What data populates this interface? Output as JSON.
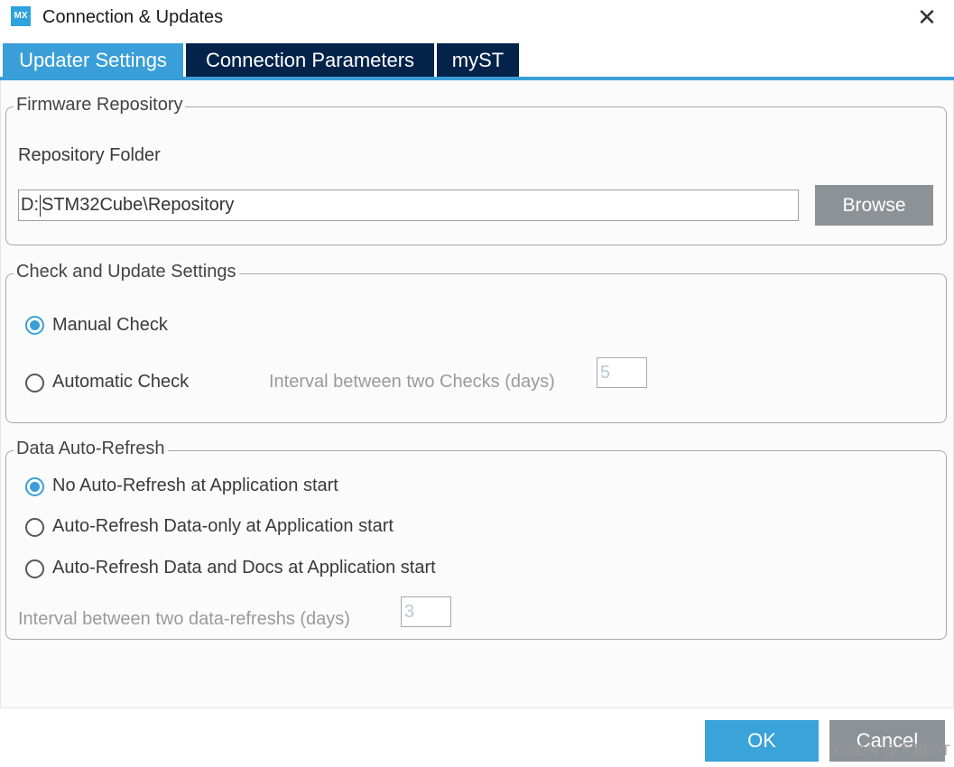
{
  "window": {
    "title": "Connection & Updates",
    "logo_text": "MX",
    "close_glyph": "✕"
  },
  "tabs": [
    {
      "label": "Updater Settings",
      "active": true
    },
    {
      "label": "Connection Parameters",
      "active": false
    },
    {
      "label": "myST",
      "active": false
    }
  ],
  "firmware_repository": {
    "legend": "Firmware Repository",
    "folder_label": "Repository Folder",
    "folder_value_prefix": "D:",
    "folder_value_rest": "STM32Cube\\Repository",
    "browse_label": "Browse"
  },
  "check_update": {
    "legend": "Check and Update Settings",
    "manual_label": "Manual Check",
    "manual_selected": true,
    "automatic_label": "Automatic Check",
    "automatic_selected": false,
    "interval_label": "Interval between two Checks (days)",
    "interval_value": "5"
  },
  "data_refresh": {
    "legend": "Data Auto-Refresh",
    "options": [
      {
        "label": "No Auto-Refresh at Application start",
        "selected": true
      },
      {
        "label": "Auto-Refresh Data-only at Application start",
        "selected": false
      },
      {
        "label": "Auto-Refresh Data and Docs at Application start",
        "selected": false
      }
    ],
    "interval_label": "Interval between two data-refreshs (days)",
    "interval_value": "3"
  },
  "footer": {
    "ok_label": "OK",
    "cancel_label": "Cancel",
    "watermark": "CSDN @大狼IoT"
  },
  "colors": {
    "accent": "#3a9fd8",
    "tab_inactive": "#03234b",
    "button_gray": "#8d9297"
  },
  "icons": {
    "logo": "mx-logo-icon",
    "close": "close-icon",
    "radio": "radio-button"
  }
}
